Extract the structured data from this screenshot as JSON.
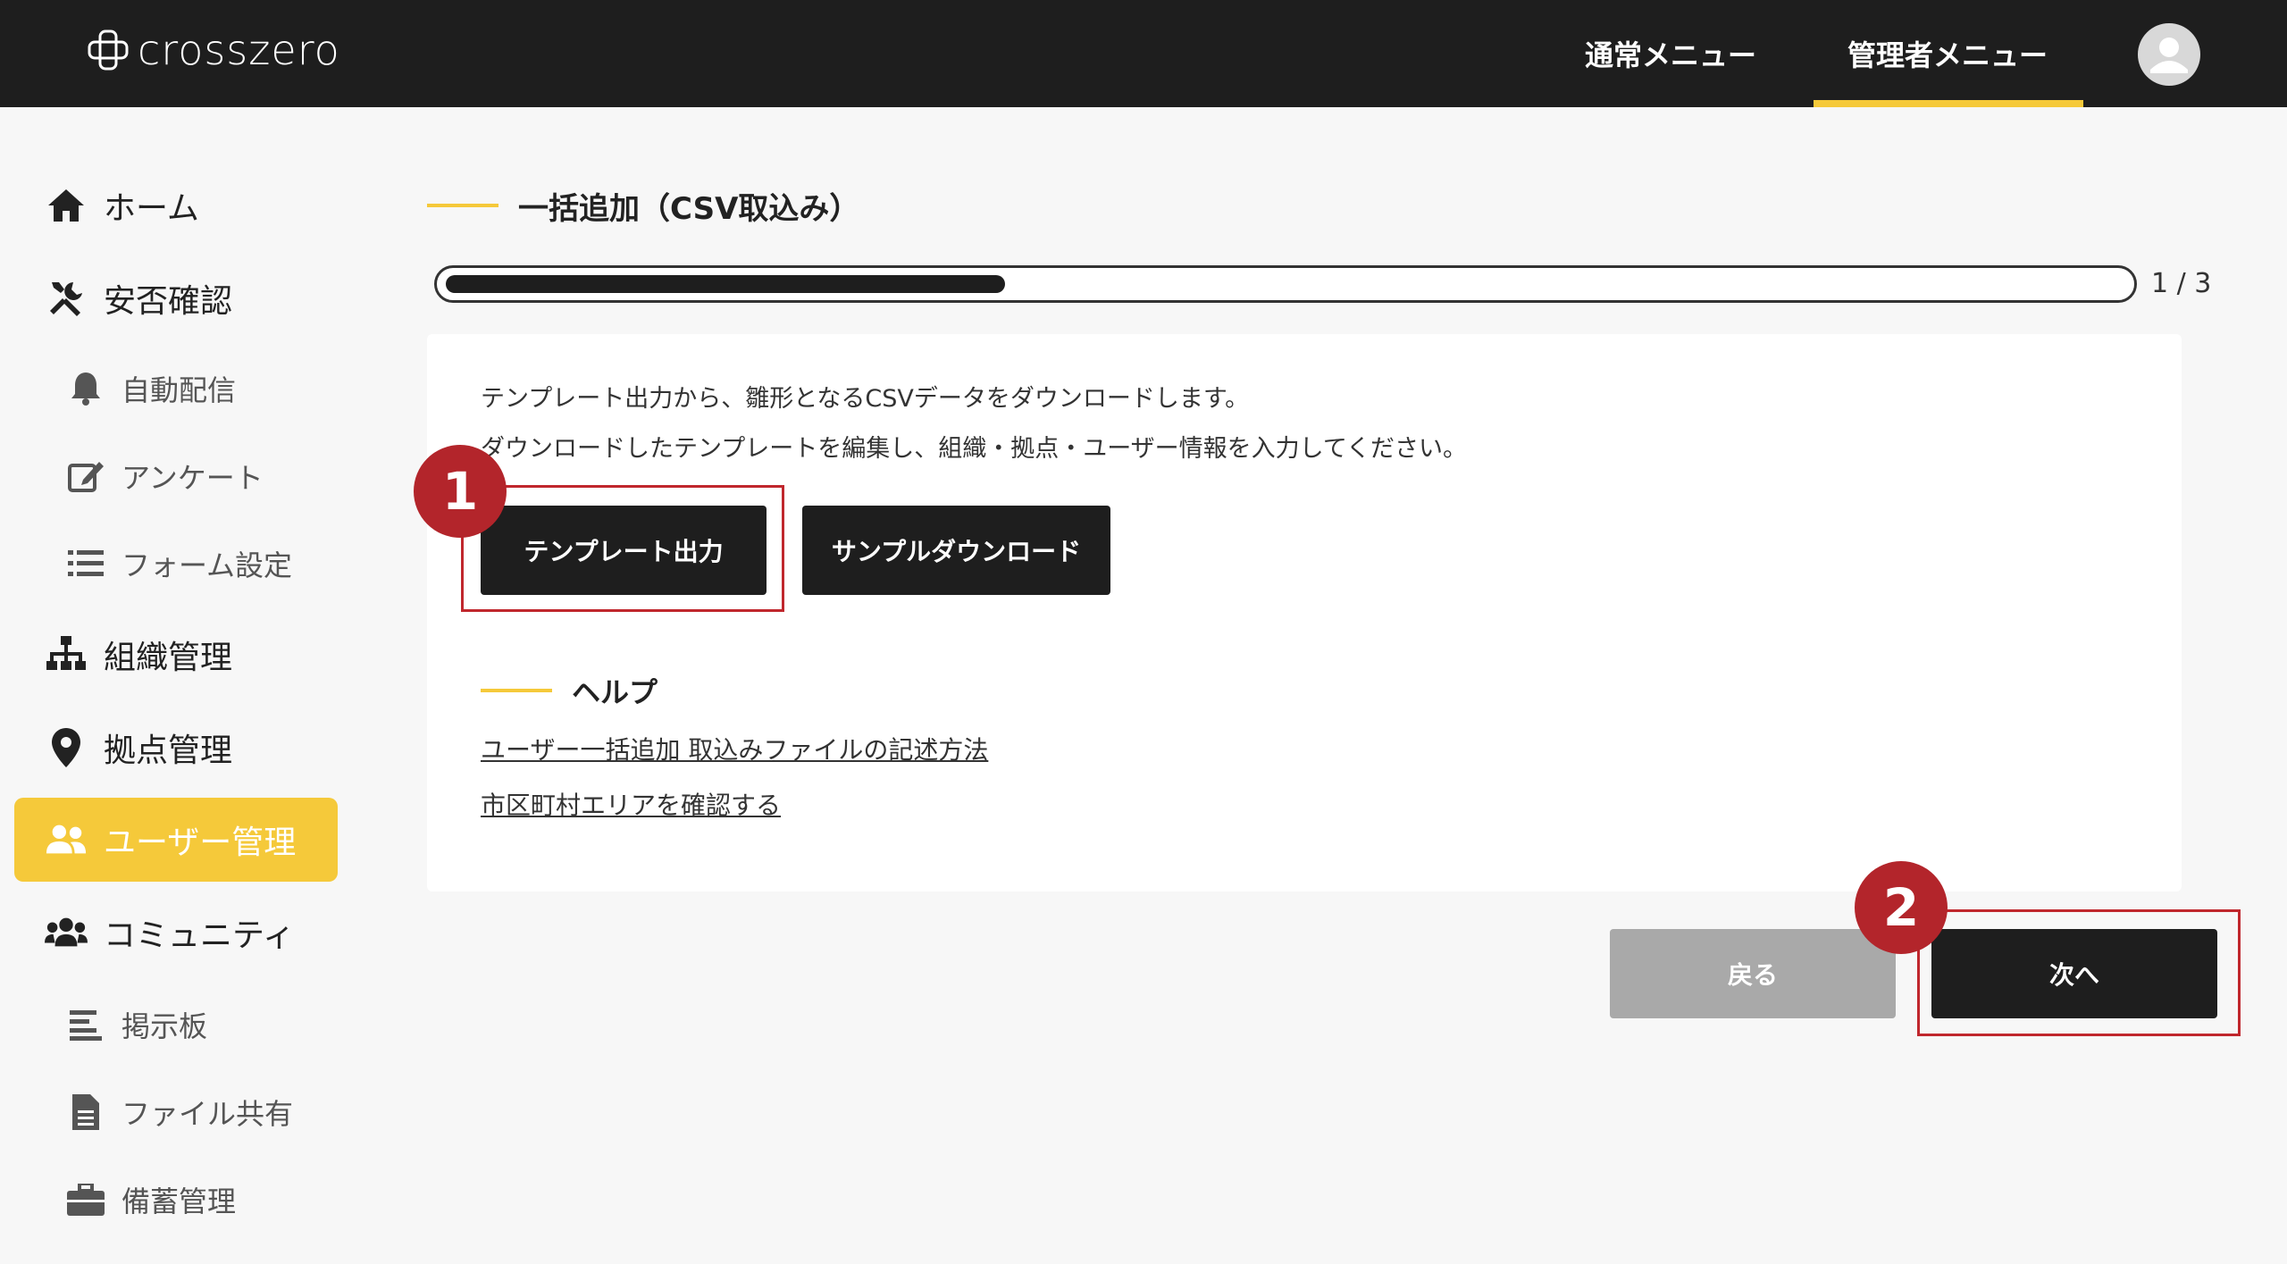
{
  "header": {
    "logo_text": "crosszero",
    "nav_normal": "通常メニュー",
    "nav_admin": "管理者メニュー"
  },
  "sidebar": {
    "items": [
      {
        "label": "ホーム",
        "icon": "home-icon"
      },
      {
        "label": "安否確認",
        "icon": "tools-icon"
      },
      {
        "label": "自動配信",
        "icon": "bell-icon"
      },
      {
        "label": "アンケート",
        "icon": "edit-icon"
      },
      {
        "label": "フォーム設定",
        "icon": "list-icon"
      },
      {
        "label": "組織管理",
        "icon": "org-chart-icon"
      },
      {
        "label": "拠点管理",
        "icon": "map-pin-icon"
      },
      {
        "label": "ユーザー管理",
        "icon": "users-icon",
        "active": true
      },
      {
        "label": "コミュニティ",
        "icon": "community-icon"
      },
      {
        "label": "掲示板",
        "icon": "align-left-icon"
      },
      {
        "label": "ファイル共有",
        "icon": "file-icon"
      },
      {
        "label": "備蓄管理",
        "icon": "briefcase-icon"
      }
    ]
  },
  "main": {
    "title": "一括追加（CSV取込み）",
    "progress": {
      "current": 1,
      "total": 3,
      "label": "1 / 3",
      "fraction": 0.333
    },
    "description_line1": "テンプレート出力から、雛形となるCSVデータをダウンロードします。",
    "description_line2": "ダウンロードしたテンプレートを編集し、組織・拠点・ユーザー情報を入力してください。",
    "template_button": "テンプレート出力",
    "sample_button": "サンプルダウンロード",
    "help_title": "ヘルプ",
    "help_links": [
      "ユーザー一括追加 取込みファイルの記述方法",
      "市区町村エリアを確認する"
    ],
    "back_button": "戻る",
    "next_button": "次へ"
  },
  "annotations": {
    "step1": "1",
    "step2": "2"
  },
  "colors": {
    "topbar": "#1e1e1e",
    "accent": "#f5c93a",
    "highlight": "#c0272d",
    "badge": "#b3252b"
  }
}
